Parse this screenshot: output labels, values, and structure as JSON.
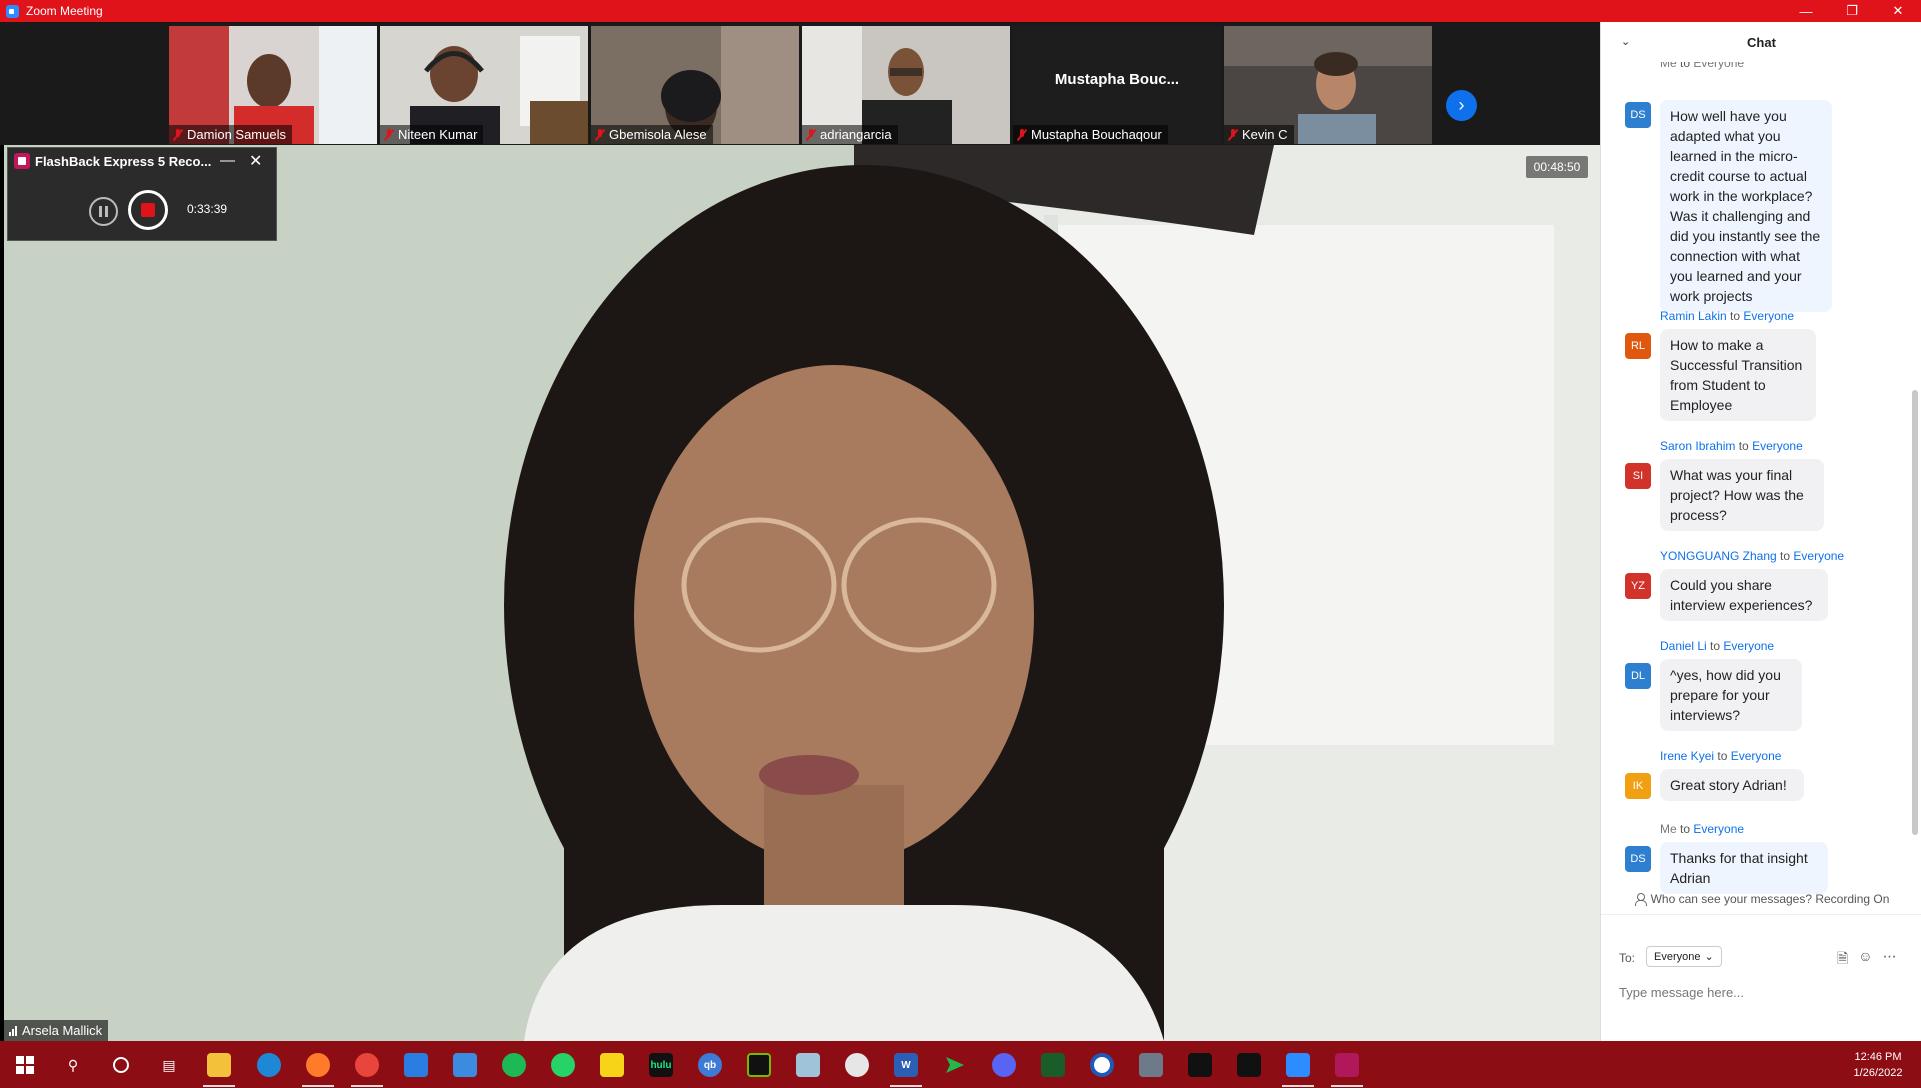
{
  "window": {
    "title": "Zoom Meeting"
  },
  "gallery": {
    "participants": [
      {
        "name": "Damion Samuels"
      },
      {
        "name": "Niteen Kumar"
      },
      {
        "name": "Gbemisola Alese"
      },
      {
        "name": "adriangarcia"
      },
      {
        "name": "Mustapha Bouchaqour",
        "display": "Mustapha  Bouc..."
      },
      {
        "name": "Kevin C"
      }
    ]
  },
  "main": {
    "speaker": "Arsela Mallick",
    "recording_time": "00:48:50"
  },
  "flashback": {
    "title": "FlashBack Express 5 Reco...",
    "elapsed": "0:33:39"
  },
  "chat": {
    "title": "Chat",
    "messages": [
      {
        "initials": "DS",
        "color": "#2f7fd1",
        "sender": "Me",
        "to_word": "to",
        "recipient": "Everyone",
        "text": "How well have you adapted what you learned in the micro-credit course to actual work in the workplace? Was it challenging and did you instantly see the connection with what you learned and your work projects"
      },
      {
        "initials": "RL",
        "color": "#e0580e",
        "sender": "Ramin Lakin",
        "to_word": "to",
        "recipient": "Everyone",
        "text": "How to make a Successful Transition from Student to Employee"
      },
      {
        "initials": "SI",
        "color": "#d1322a",
        "sender": "Saron Ibrahim",
        "to_word": "to",
        "recipient": "Everyone",
        "text": "What was your final project? How was the process?"
      },
      {
        "initials": "YZ",
        "color": "#d1322a",
        "sender": "YONGGUANG Zhang",
        "to_word": "to",
        "recipient": "Everyone",
        "text": "Could you share interview experiences?"
      },
      {
        "initials": "DL",
        "color": "#2f7fd1",
        "sender": "Daniel Li",
        "to_word": "to",
        "recipient": "Everyone",
        "text": "^yes, how did you prepare for your interviews?"
      },
      {
        "initials": "IK",
        "color": "#f0a012",
        "sender": "Irene Kyei",
        "to_word": "to",
        "recipient": "Everyone",
        "text": "Great story Adrian!"
      },
      {
        "initials": "DS",
        "color": "#2f7fd1",
        "sender": "Me",
        "to_word": "to",
        "recipient": "Everyone",
        "text": "Thanks for that insight Adrian"
      }
    ],
    "privacy_notice": "Who can see your messages? Recording On",
    "to_label": "To:",
    "to_value": "Everyone",
    "input_placeholder": "Type message here..."
  },
  "taskbar": {
    "apps": [
      "start",
      "search",
      "cortana",
      "task-view",
      "file-explorer",
      "edge",
      "firefox",
      "chrome",
      "mail",
      "store",
      "spotify",
      "whatsapp",
      "sticky-notes",
      "hulu",
      "qbittorrent",
      "nvidia",
      "notes",
      "paint",
      "word",
      "send",
      "discord",
      "trees",
      "circle-app",
      "calculator",
      "tidal",
      "tradingview",
      "zoom",
      "presenter"
    ],
    "apps_text": {
      "hulu": "hulu",
      "qbittorrent": "qb",
      "word": "W"
    },
    "time": "12:46 PM",
    "date": "1/26/2022"
  }
}
